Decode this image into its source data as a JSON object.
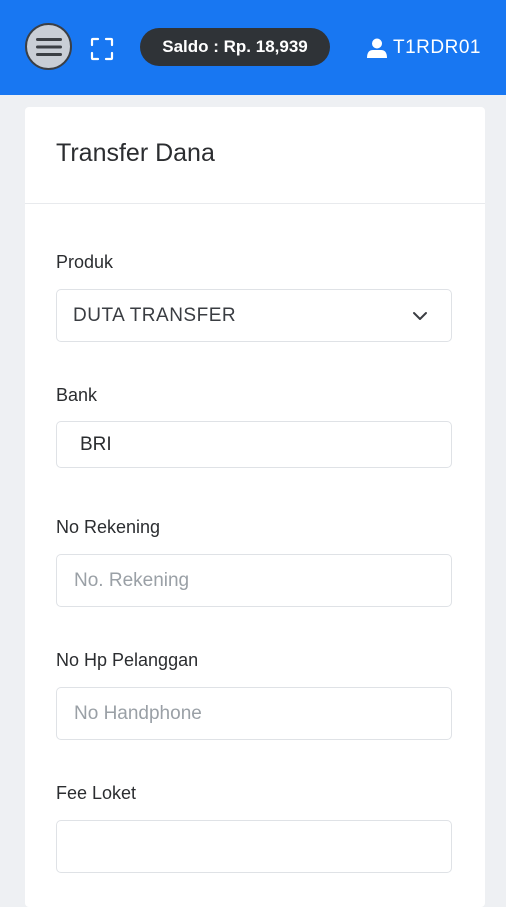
{
  "header": {
    "saldo_label": "Saldo : Rp. 18,939",
    "username": "T1RDR01",
    "menu_icon": "hamburger-menu-icon",
    "expand_icon": "fullscreen-expand-icon",
    "user_icon": "user-icon",
    "bar_color": "#1877f2"
  },
  "card": {
    "title": "Transfer Dana",
    "fields": {
      "produk": {
        "label": "Produk",
        "value": "DUTA TRANSFER"
      },
      "bank": {
        "label": "Bank",
        "value": "BRI"
      },
      "no_rekening": {
        "label": "No Rekening",
        "placeholder": "No. Rekening"
      },
      "no_hp": {
        "label": "No Hp Pelanggan",
        "placeholder": "No Handphone"
      },
      "fee_loket": {
        "label": "Fee Loket",
        "value": ""
      }
    }
  }
}
